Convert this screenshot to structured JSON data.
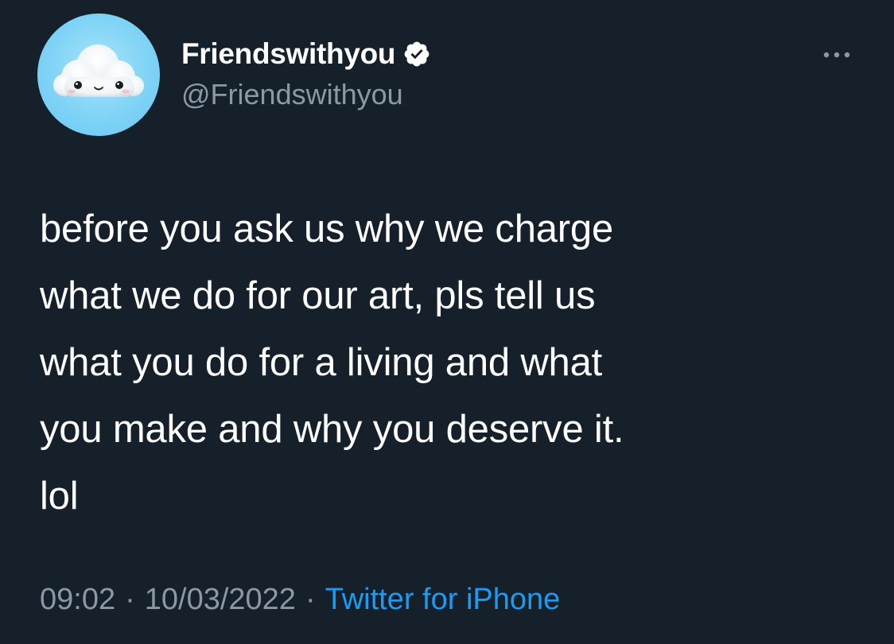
{
  "author": {
    "display_name": "Friendswithyou",
    "handle": "@Friendswithyou",
    "verified": true,
    "avatar": "cloud-avatar-icon"
  },
  "menu": {
    "icon": "more-options-icon"
  },
  "tweet": {
    "lines": [
      "before you ask us why we charge",
      "what we do for our art, pls tell us",
      "what you do for a living and what",
      "you make and why you deserve it.",
      "lol"
    ]
  },
  "meta": {
    "time": "09:02",
    "separator": "·",
    "date": "10/03/2022",
    "source": "Twitter for iPhone"
  },
  "colors": {
    "background": "#15202b",
    "primary_text": "#ffffff",
    "secondary_text": "#8b98a5",
    "link": "#1d9bf0"
  }
}
